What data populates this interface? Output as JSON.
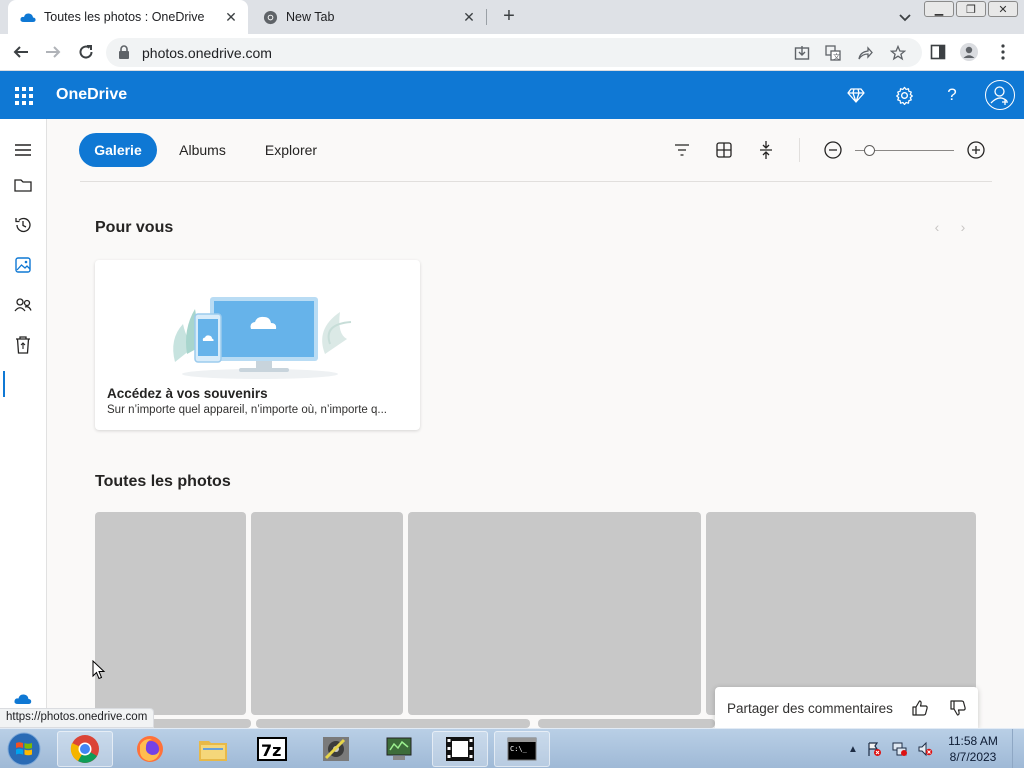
{
  "browser": {
    "tabs": [
      {
        "title": "Toutes les photos : OneDrive",
        "icon": "onedrive-cloud-icon",
        "active": true
      },
      {
        "title": "New Tab",
        "icon": "chrome-icon",
        "active": false
      }
    ],
    "url": "photos.onedrive.com",
    "status_url": "https://photos.onedrive.com"
  },
  "onedrive": {
    "app_name": "OneDrive",
    "brand_color": "#0f78d4",
    "pivots": [
      {
        "label": "Galerie",
        "active": true
      },
      {
        "label": "Albums",
        "active": false
      },
      {
        "label": "Explorer",
        "active": false
      }
    ],
    "for_you": {
      "title": "Pour vous",
      "card": {
        "title": "Accédez à vos souvenirs",
        "subtitle": "Sur n’importe quel appareil, n’importe où, n’importe q..."
      }
    },
    "all_photos": {
      "title": "Toutes les photos"
    },
    "feedback": {
      "label": "Partager des commentaires"
    },
    "zoom_level": 0.15
  },
  "taskbar": {
    "apps": [
      "chrome",
      "firefox",
      "file-explorer",
      "7zip",
      "app-gear",
      "network-app",
      "video-app",
      "command-prompt"
    ],
    "clock": {
      "time": "11:58 AM",
      "date": "8/7/2023"
    }
  }
}
